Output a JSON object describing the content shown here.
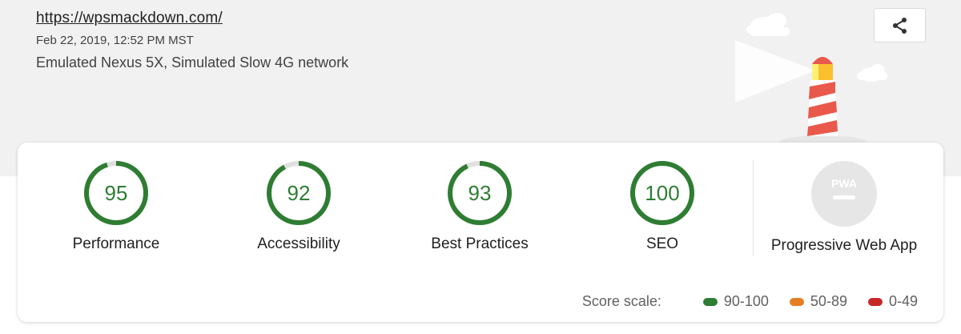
{
  "header": {
    "url": "https://wpsmackdown.com/",
    "timestamp": "Feb 22, 2019, 12:52 PM MST",
    "environment": "Emulated Nexus 5X, Simulated Slow 4G network",
    "share_icon": "share-icon"
  },
  "colors": {
    "pass": "#2e7d32",
    "average": "#e67e22",
    "fail": "#c62828",
    "neutral_track": "#e0e0e0",
    "pwa_badge": "#e6e6e6"
  },
  "categories": [
    {
      "label": "Performance",
      "score": "95",
      "fraction": 0.95
    },
    {
      "label": "Accessibility",
      "score": "92",
      "fraction": 0.92
    },
    {
      "label": "Best Practices",
      "score": "93",
      "fraction": 0.93
    },
    {
      "label": "SEO",
      "score": "100",
      "fraction": 1.0
    }
  ],
  "pwa": {
    "badge_text": "PWA",
    "label": "Progressive Web App"
  },
  "score_scale": {
    "title": "Score scale:",
    "ranges": [
      {
        "label": "90-100",
        "color": "#2e7d32"
      },
      {
        "label": "50-89",
        "color": "#e67e22"
      },
      {
        "label": "0-49",
        "color": "#c62828"
      }
    ]
  }
}
